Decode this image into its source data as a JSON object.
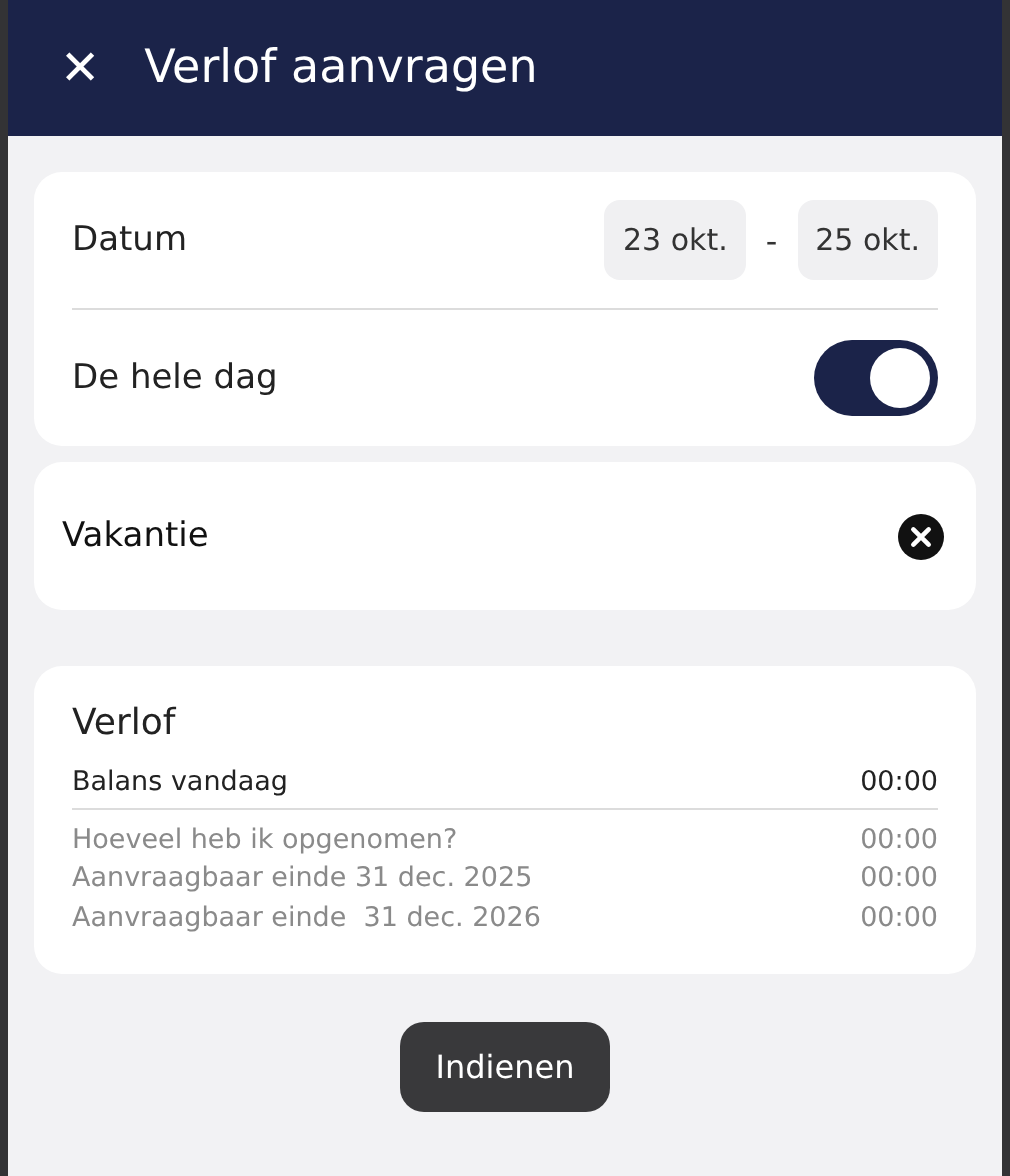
{
  "header": {
    "close_icon": "✕",
    "title": "Verlof aanvragen"
  },
  "date": {
    "label": "Datum",
    "from": "23 okt.",
    "separator": "-",
    "to": "25 okt."
  },
  "all_day": {
    "label": "De hele dag",
    "on": true
  },
  "description": {
    "value": "Vakantie"
  },
  "balance": {
    "title": "Verlof",
    "rows": [
      {
        "kind": "primary",
        "label": "Balans vandaag",
        "value": "00:00"
      },
      {
        "kind": "secondary",
        "label": "Hoeveel heb ik opgenomen?",
        "value": "00:00"
      },
      {
        "kind": "secondary",
        "label": "Aanvraagbaar einde 31 dec. 2025",
        "value": "00:00"
      },
      {
        "kind": "secondary",
        "label": "Aanvraagbaar einde  31 dec. 2026",
        "value": "00:00"
      }
    ]
  },
  "submit": "Indienen"
}
